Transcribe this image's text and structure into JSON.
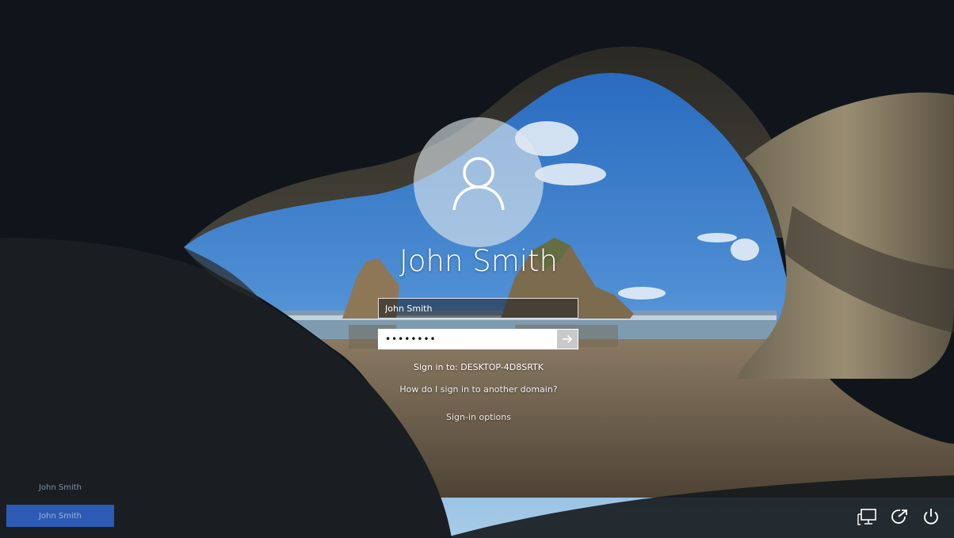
{
  "login": {
    "display_name": "John Smith",
    "username_value": "John Smith",
    "password_value": "••••••••",
    "sign_in_to": "Sign in to: DESKTOP-4D8SRTK",
    "domain_help_link": "How do I sign in to another domain?",
    "sign_in_options": "Sign-in options"
  },
  "user_switcher": {
    "users": [
      {
        "name": "John Smith"
      },
      {
        "name": "John Smith",
        "selected": true
      }
    ]
  },
  "system_tray": {
    "icons": [
      "network-icon",
      "ease-of-access-icon",
      "power-icon"
    ]
  },
  "colors": {
    "selected_user": "#2d5bb3",
    "text": "#ffffff"
  }
}
